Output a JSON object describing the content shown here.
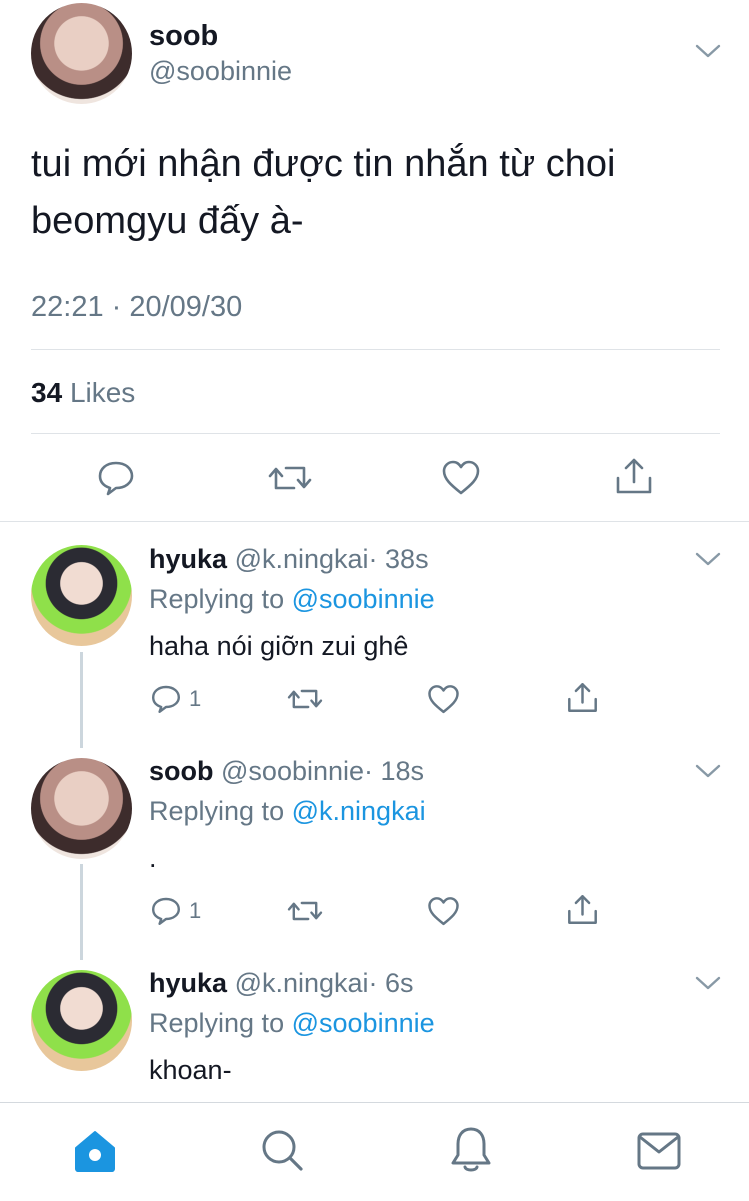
{
  "main_tweet": {
    "name": "soob",
    "handle": "@soobinnie",
    "text_line1": "tui mới nhận được tin nhắn từ choi",
    "text_line2": "beomgyu đấy à-",
    "timestamp": "22:21 · 20/09/30",
    "likes_count": "34",
    "likes_label": "Likes"
  },
  "replies": [
    {
      "name": "hyuka",
      "handle": "@k.ningkai",
      "time": "· 38s",
      "replying_prefix": "Replying to",
      "replying_to": "@soobinnie",
      "text": "haha nói giỡn zui ghê",
      "reply_count": "1"
    },
    {
      "name": "soob",
      "handle": "@soobinnie",
      "time": "· 18s",
      "replying_prefix": "Replying to",
      "replying_to": "@k.ningkai",
      "text": ".",
      "reply_count": "1"
    },
    {
      "name": "hyuka",
      "handle": "@k.ningkai",
      "time": "· 6s",
      "replying_prefix": "Replying to",
      "replying_to": "@soobinnie",
      "text": "khoan-"
    }
  ],
  "colors": {
    "accent": "#1b95e0",
    "text": "#141823",
    "muted": "#657786",
    "divider": "#dfe3e7"
  },
  "icons": [
    "chevron-down-icon",
    "reply-icon",
    "retweet-icon",
    "like-icon",
    "share-icon",
    "home-icon",
    "search-icon",
    "notifications-icon",
    "messages-icon"
  ]
}
